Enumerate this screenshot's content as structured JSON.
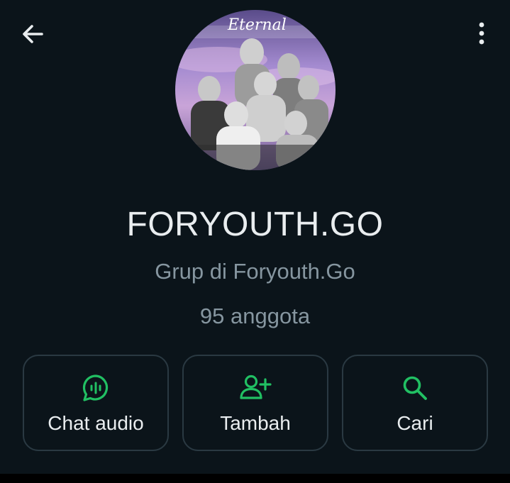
{
  "header": {
    "back_icon": "arrow-left-icon",
    "menu_icon": "more-vertical-icon"
  },
  "profile": {
    "avatar_overlay_text": "Eternal",
    "name": "FORYOUTH.GO",
    "subtitle": "Grup di Foryouth.Go",
    "member_count": "95 anggota"
  },
  "actions": [
    {
      "label": "Chat audio",
      "icon": "audio-chat-icon"
    },
    {
      "label": "Tambah",
      "icon": "add-person-icon"
    },
    {
      "label": "Cari",
      "icon": "search-icon"
    }
  ],
  "colors": {
    "background": "#0b141a",
    "accent": "#21c063",
    "primary_text": "#e9edef",
    "secondary_text": "#8696a0",
    "button_border": "#2a3942"
  }
}
